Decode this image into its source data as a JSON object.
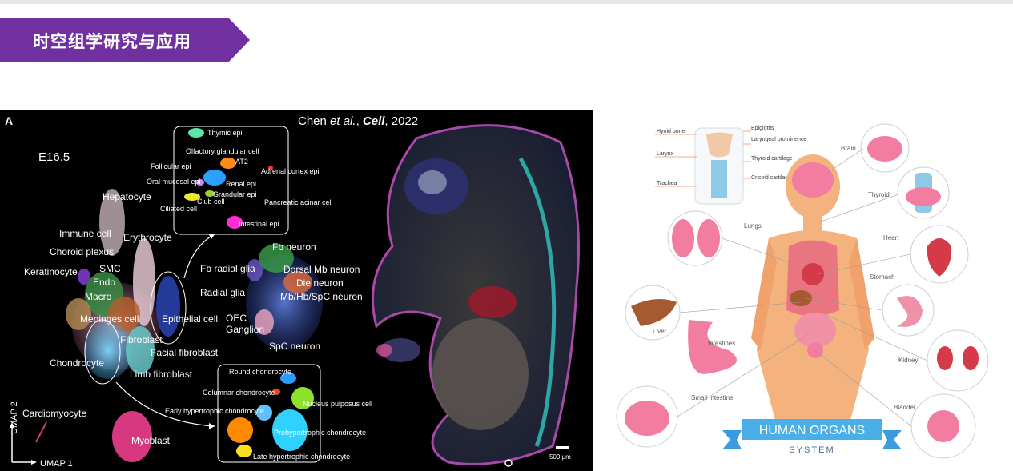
{
  "slide": {
    "title": "时空组学研究与应用",
    "colors": {
      "banner": "#7030a0",
      "rule": "#e6e6e6",
      "infographic_ribbon": "#3a9be0"
    }
  },
  "figure_left": {
    "panel_letter": "A",
    "citation": {
      "authors": "Chen ",
      "etal": "et al.",
      "sep": ", ",
      "journal": "Cell",
      "year": ", 2022"
    },
    "stage": "E16.5",
    "axes": {
      "x": "UMAP 1",
      "y": "UMAP 2"
    },
    "cluster_labels": [
      "Hepatocyte",
      "Immune cell",
      "Erythrocyte",
      "Choroid plexus",
      "SMC",
      "Keratinocyte",
      "Endo",
      "Macro",
      "Meninges cell",
      "Epithelial cell",
      "Fibroblast",
      "Facial fibroblast",
      "Chondrocyte",
      "Limb fibroblast",
      "Cardiomyocyte",
      "Myoblast",
      "Fb neuron",
      "Fb radial glia",
      "Dorsal Mb neuron",
      "Die neuron",
      "Radial glia",
      "Mb/Hb/SpC neuron",
      "OEC",
      "Ganglion",
      "SpC neuron"
    ],
    "epi_inset_labels": [
      "Thymic epi",
      "Olfactory glandular cell",
      "Follicular epi",
      "AT2",
      "Adrenal cortex epi",
      "Oral mucosal epi",
      "Renal epi",
      "Grandular epi",
      "Ciliated cell",
      "Club cell",
      "Pancreatic acinar cell",
      "Intestinal epi"
    ],
    "chondro_inset_labels": [
      "Round chondrocyte",
      "Columnar chondrocyte",
      "Nucleus pulposus cell",
      "Early hypertrophic chondrocyte",
      "Prehypertrophic chondrocyte",
      "Late hypertrophic chondrocyte"
    ],
    "scale_bar": "500 μm"
  },
  "figure_right": {
    "larynx_labels": [
      "Hyoid bone",
      "Larynx",
      "Trachea",
      "Epiglottis",
      "Laryngeal prominence",
      "Thyroid cartilage",
      "Cricoid cartilage"
    ],
    "organ_labels": [
      "Brain",
      "Thyroid",
      "Lungs",
      "Heart",
      "Stomach",
      "Liver",
      "Intestines",
      "Kidney",
      "Small Intestine",
      "Bladder"
    ],
    "ribbon_title": "HUMAN ORGANS",
    "ribbon_subtitle": "SYSTEM"
  }
}
